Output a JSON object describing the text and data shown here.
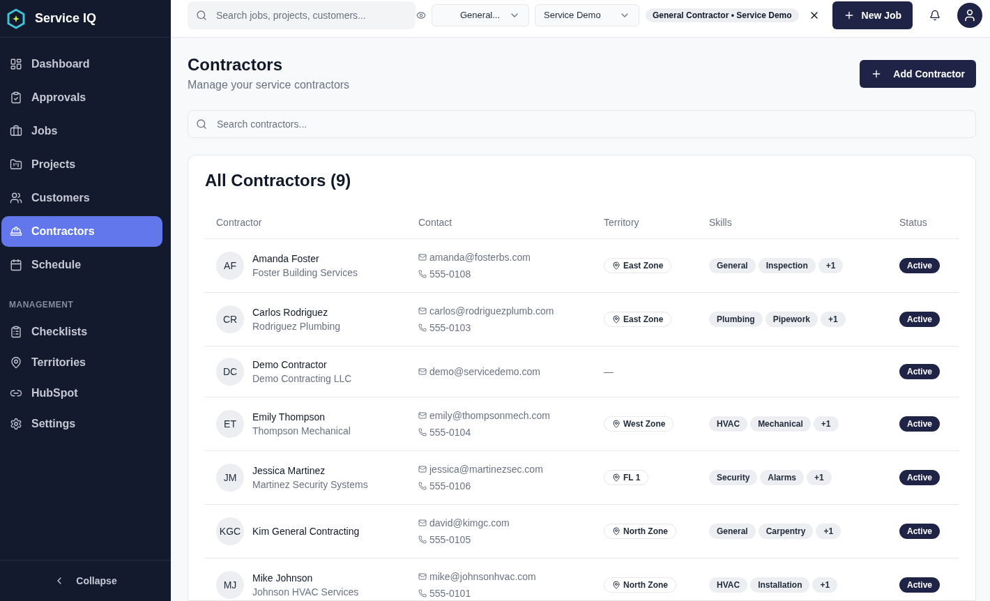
{
  "sidebar": {
    "brand": "Service IQ",
    "nav": [
      {
        "label": "Dashboard",
        "selected": false
      },
      {
        "label": "Approvals",
        "selected": false
      },
      {
        "label": "Jobs",
        "selected": false
      },
      {
        "label": "Projects",
        "selected": false
      },
      {
        "label": "Customers",
        "selected": false
      },
      {
        "label": "Contractors",
        "selected": true
      },
      {
        "label": "Schedule",
        "selected": false
      }
    ],
    "management": {
      "label": "MANAGEMENT",
      "items": [
        {
          "label": "Checklists",
          "selected": false
        },
        {
          "label": "Territories",
          "selected": false
        },
        {
          "label": "HubSpot",
          "selected": false
        },
        {
          "label": "Settings",
          "selected": false
        }
      ]
    },
    "collapse": "Collapse"
  },
  "topbar": {
    "search": {
      "placeholder": "Search jobs, projects, customers..."
    },
    "filters": [
      {
        "value": "General..."
      },
      {
        "value": "Service Demo"
      }
    ],
    "context_tag": "General Contractor • Service Demo",
    "new_job": "New Job"
  },
  "page": {
    "title": "Contractors",
    "subtitle": "Manage your service contractors",
    "add_button": "Add Contractor",
    "search": {
      "placeholder": "Search contractors..."
    }
  },
  "table": {
    "title": "All Contractors (9)",
    "columns": [
      "Contractor",
      "Contact",
      "Territory",
      "Skills",
      "Status"
    ],
    "rows": [
      {
        "initials": "AF",
        "name": "Amanda Foster",
        "company": "Foster Building Services",
        "email": "amanda@fosterbs.com",
        "phone": "555-0108",
        "territory": {
          "kind": "zone",
          "label": "East Zone"
        },
        "skills": [
          "General",
          "Inspection"
        ],
        "more": "+1",
        "status": "Active"
      },
      {
        "initials": "CR",
        "name": "Carlos Rodriguez",
        "company": "Rodriguez Plumbing",
        "email": "carlos@rodriguezplumb.com",
        "phone": "555-0103",
        "territory": {
          "kind": "zone",
          "label": "East Zone"
        },
        "skills": [
          "Plumbing",
          "Pipework"
        ],
        "more": "+1",
        "status": "Active"
      },
      {
        "initials": "DC",
        "name": "Demo Contractor",
        "company": "Demo Contracting LLC",
        "email": "demo@servicedemo.com",
        "territory": {
          "kind": "none",
          "label": "—"
        },
        "status": "Active"
      },
      {
        "initials": "ET",
        "name": "Emily Thompson",
        "company": "Thompson Mechanical",
        "email": "emily@thompsonmech.com",
        "phone": "555-0104",
        "territory": {
          "kind": "zone",
          "label": "West Zone"
        },
        "skills": [
          "HVAC",
          "Mechanical"
        ],
        "more": "+1",
        "status": "Active"
      },
      {
        "initials": "JM",
        "name": "Jessica Martinez",
        "company": "Martinez Security Systems",
        "email": "jessica@martinezsec.com",
        "phone": "555-0106",
        "territory": {
          "kind": "zone",
          "label": "FL 1"
        },
        "skills": [
          "Security",
          "Alarms"
        ],
        "more": "+1",
        "status": "Active"
      },
      {
        "initials": "KGC",
        "name": "Kim General Contracting",
        "email": "david@kimgc.com",
        "phone": "555-0105",
        "territory": {
          "kind": "zone",
          "label": "North Zone"
        },
        "skills": [
          "General",
          "Carpentry"
        ],
        "more": "+1",
        "status": "Active"
      },
      {
        "initials": "MJ",
        "name": "Mike Johnson",
        "company": "Johnson HVAC Services",
        "email": "mike@johnsonhvac.com",
        "phone": "555-0101",
        "territory": {
          "kind": "zone",
          "label": "North Zone"
        },
        "skills": [
          "HVAC",
          "Installation"
        ],
        "more": "+1",
        "status": "Active"
      }
    ]
  }
}
